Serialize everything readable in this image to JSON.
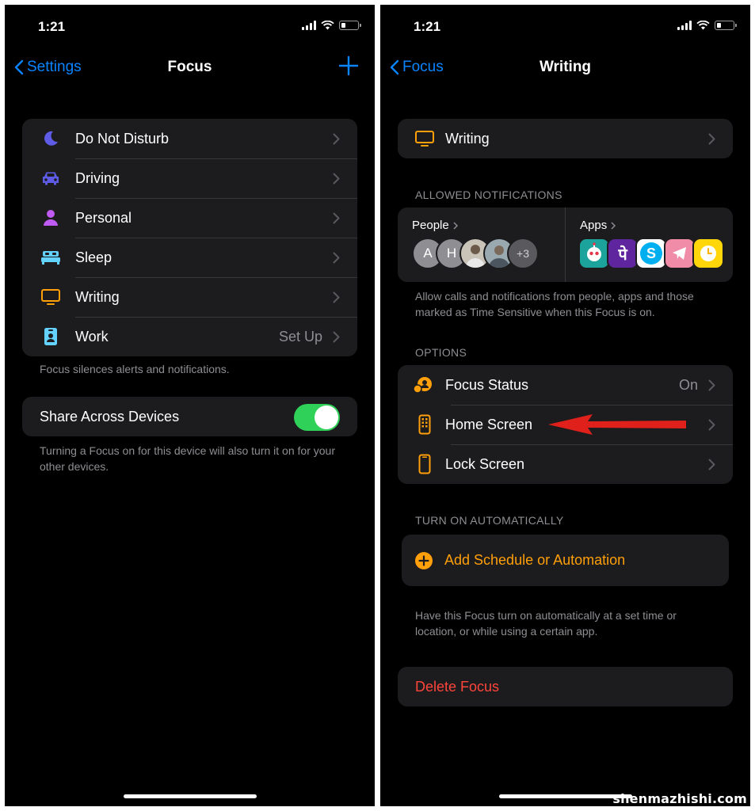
{
  "status": {
    "time": "1:21"
  },
  "left": {
    "nav": {
      "back_label": "Settings",
      "title": "Focus"
    },
    "focus_items": [
      {
        "label": "Do Not Disturb",
        "value": "",
        "icon": "moon-icon",
        "color": "#5e5ce6"
      },
      {
        "label": "Driving",
        "value": "",
        "icon": "car-icon",
        "color": "#5e5ce6"
      },
      {
        "label": "Personal",
        "value": "",
        "icon": "person-icon",
        "color": "#bf5af2"
      },
      {
        "label": "Sleep",
        "value": "",
        "icon": "bed-icon",
        "color": "#64d2ff"
      },
      {
        "label": "Writing",
        "value": "",
        "icon": "monitor-icon",
        "color": "#ff9f0a"
      },
      {
        "label": "Work",
        "value": "Set Up",
        "icon": "badge-icon",
        "color": "#64d2ff"
      }
    ],
    "focus_footer": "Focus silences alerts and notifications.",
    "share": {
      "label": "Share Across Devices",
      "on": true
    },
    "share_footer": "Turning a Focus on for this device will also turn it on for your other devices."
  },
  "right": {
    "nav": {
      "back_label": "Focus",
      "title": "Writing"
    },
    "name_row": {
      "label": "Writing",
      "icon": "monitor-icon",
      "color": "#ff9f0a"
    },
    "allowed_header": "ALLOWED NOTIFICATIONS",
    "people": {
      "title": "People",
      "avatars": [
        "A",
        "H",
        "",
        ""
      ],
      "more": "+3"
    },
    "apps": {
      "title": "Apps",
      "icons": [
        "robot-app-icon",
        "phonepe-app-icon",
        "skype-app-icon",
        "telegram-app-icon",
        "clock-app-icon"
      ],
      "phonepe_glyph": "पे",
      "skype_glyph": "S"
    },
    "allowed_footer": "Allow calls and notifications from people, apps and those marked as Time Sensitive when this Focus is on.",
    "options_header": "OPTIONS",
    "options": [
      {
        "label": "Focus Status",
        "value": "On",
        "icon": "focus-status-icon"
      },
      {
        "label": "Home Screen",
        "value": "",
        "icon": "home-screen-icon"
      },
      {
        "label": "Lock Screen",
        "value": "",
        "icon": "lock-screen-icon"
      }
    ],
    "auto_header": "TURN ON AUTOMATICALLY",
    "add_schedule": "Add Schedule or Automation",
    "auto_footer": "Have this Focus turn on automatically at a set time or location, or while using a certain app.",
    "delete": "Delete Focus"
  },
  "colors": {
    "accent": "#0a84ff",
    "orange": "#ff9f0a",
    "destructive": "#ff453a",
    "toggle_on": "#30d158",
    "annotation_arrow": "#e0201b"
  },
  "watermark": "shenmazhishi.com"
}
